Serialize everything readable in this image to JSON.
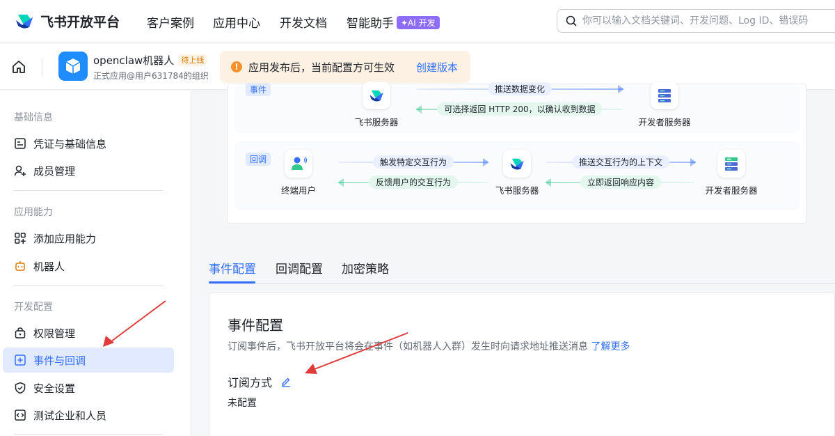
{
  "brand": {
    "name": "飞书开放平台"
  },
  "topnav": {
    "items": [
      "客户案例",
      "应用中心",
      "开发文档",
      "智能助手"
    ],
    "ai_badge": "✦AI 开发",
    "search_placeholder": "你可以输入文档关键词、开发问题、Log ID、错误码"
  },
  "app": {
    "name": "openclaw机器人",
    "status_tag": "待上线",
    "subtitle": "正式应用@用户631784的组织"
  },
  "notice": {
    "text": "应用发布后，当前配置方可生效",
    "link": "创建版本"
  },
  "sidebar": {
    "groups": [
      "基础信息",
      "应用能力",
      "开发配置"
    ],
    "items": [
      "凭证与基础信息",
      "成员管理",
      "添加应用能力",
      "机器人",
      "权限管理",
      "事件与回调",
      "安全设置",
      "测试企业和人员"
    ],
    "active_index": 5
  },
  "diagram": {
    "event": {
      "tag": "事件",
      "from": "飞书服务器",
      "to": "开发者服务器",
      "push": "推送数据变化",
      "reply": "可选择返回 HTTP 200，以确认收到数据"
    },
    "callback": {
      "tag": "回调",
      "user": "终端用户",
      "server": "飞书服务器",
      "dev": "开发者服务器",
      "trigger": "触发特定交互行为",
      "feedback": "反馈用户的交互行为",
      "push_ctx": "推送交互行为的上下文",
      "reply": "立即返回响应内容"
    }
  },
  "tabs": [
    "事件配置",
    "回调配置",
    "加密策略"
  ],
  "config": {
    "title": "事件配置",
    "desc": "订阅事件后，飞书开放平台将会在事件（如机器人入群）发生时向请求地址推送消息",
    "learn_more": "了解更多",
    "subscribe_label": "订阅方式",
    "subscribe_value": "未配置"
  },
  "colors": {
    "accent": "#3370ff",
    "annotation": "#e03b3b"
  }
}
